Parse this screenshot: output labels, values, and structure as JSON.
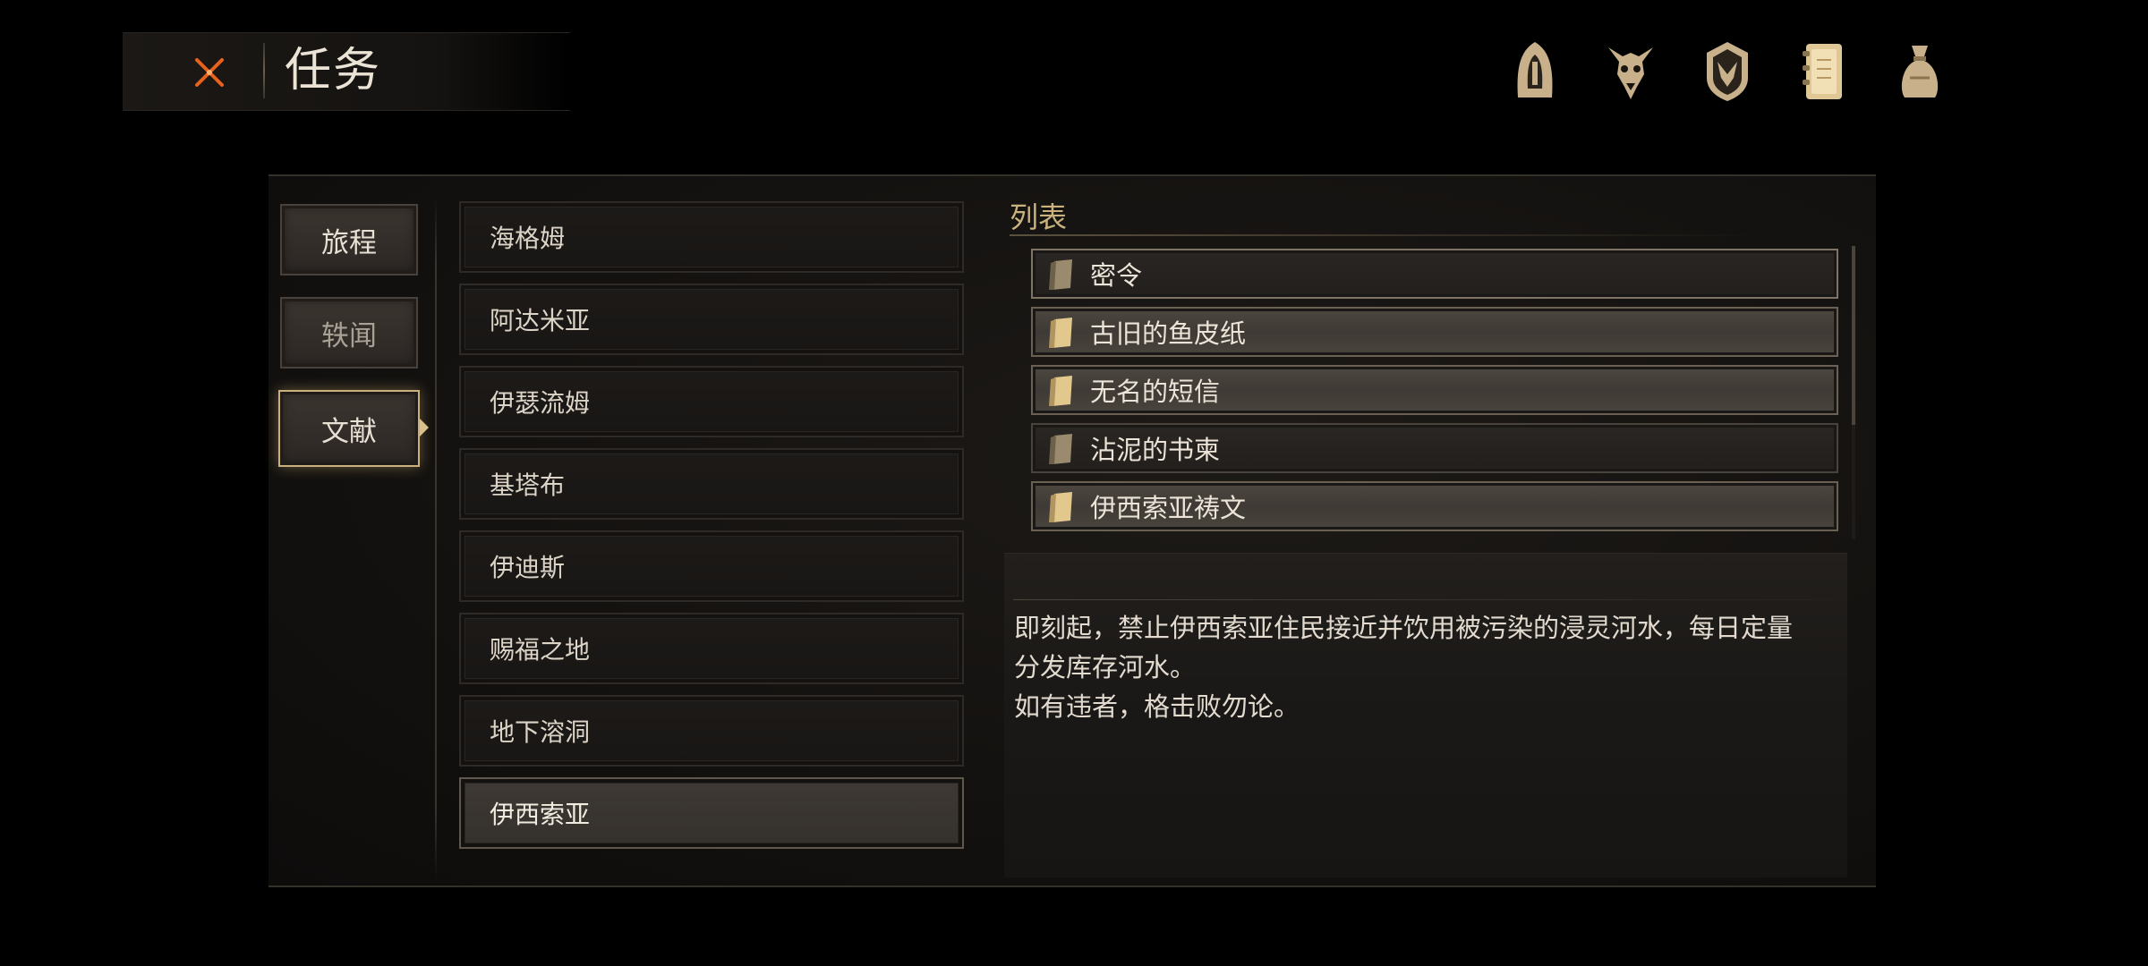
{
  "header": {
    "title": "任务",
    "close_icon": "close-x-icon"
  },
  "top_icons": [
    {
      "name": "hooded-knight-icon"
    },
    {
      "name": "beast-skull-icon"
    },
    {
      "name": "shield-emblem-icon"
    },
    {
      "name": "journal-book-icon",
      "selected": true
    },
    {
      "name": "pouch-bag-icon"
    }
  ],
  "categories": [
    {
      "label": "旅程",
      "active": false
    },
    {
      "label": "轶闻",
      "active": false
    },
    {
      "label": "文献",
      "active": true
    }
  ],
  "regions": [
    {
      "label": "海格姆"
    },
    {
      "label": "阿达米亚"
    },
    {
      "label": "伊瑟流姆"
    },
    {
      "label": "基塔布"
    },
    {
      "label": "伊迪斯"
    },
    {
      "label": "赐福之地"
    },
    {
      "label": "地下溶洞"
    },
    {
      "label": "伊西索亚",
      "active": true
    }
  ],
  "list": {
    "title": "列表",
    "items": [
      {
        "label": "密令",
        "highlighted": false,
        "selected": true
      },
      {
        "label": "古旧的鱼皮纸",
        "highlighted": true
      },
      {
        "label": "无名的短信",
        "highlighted": true
      },
      {
        "label": "沾泥的书柬",
        "highlighted": false
      },
      {
        "label": "伊西索亚祷文",
        "highlighted": true
      }
    ]
  },
  "detail": {
    "text": "即刻起，禁止伊西索亚住民接近并饮用被污染的浸灵河水，每日定量\n分发库存河水。\n如有违者，格击败勿论。"
  },
  "colors": {
    "accent_gold": "#c9b27e",
    "close_orange": "#e8621c",
    "icon_tan": "#c8b08a"
  }
}
